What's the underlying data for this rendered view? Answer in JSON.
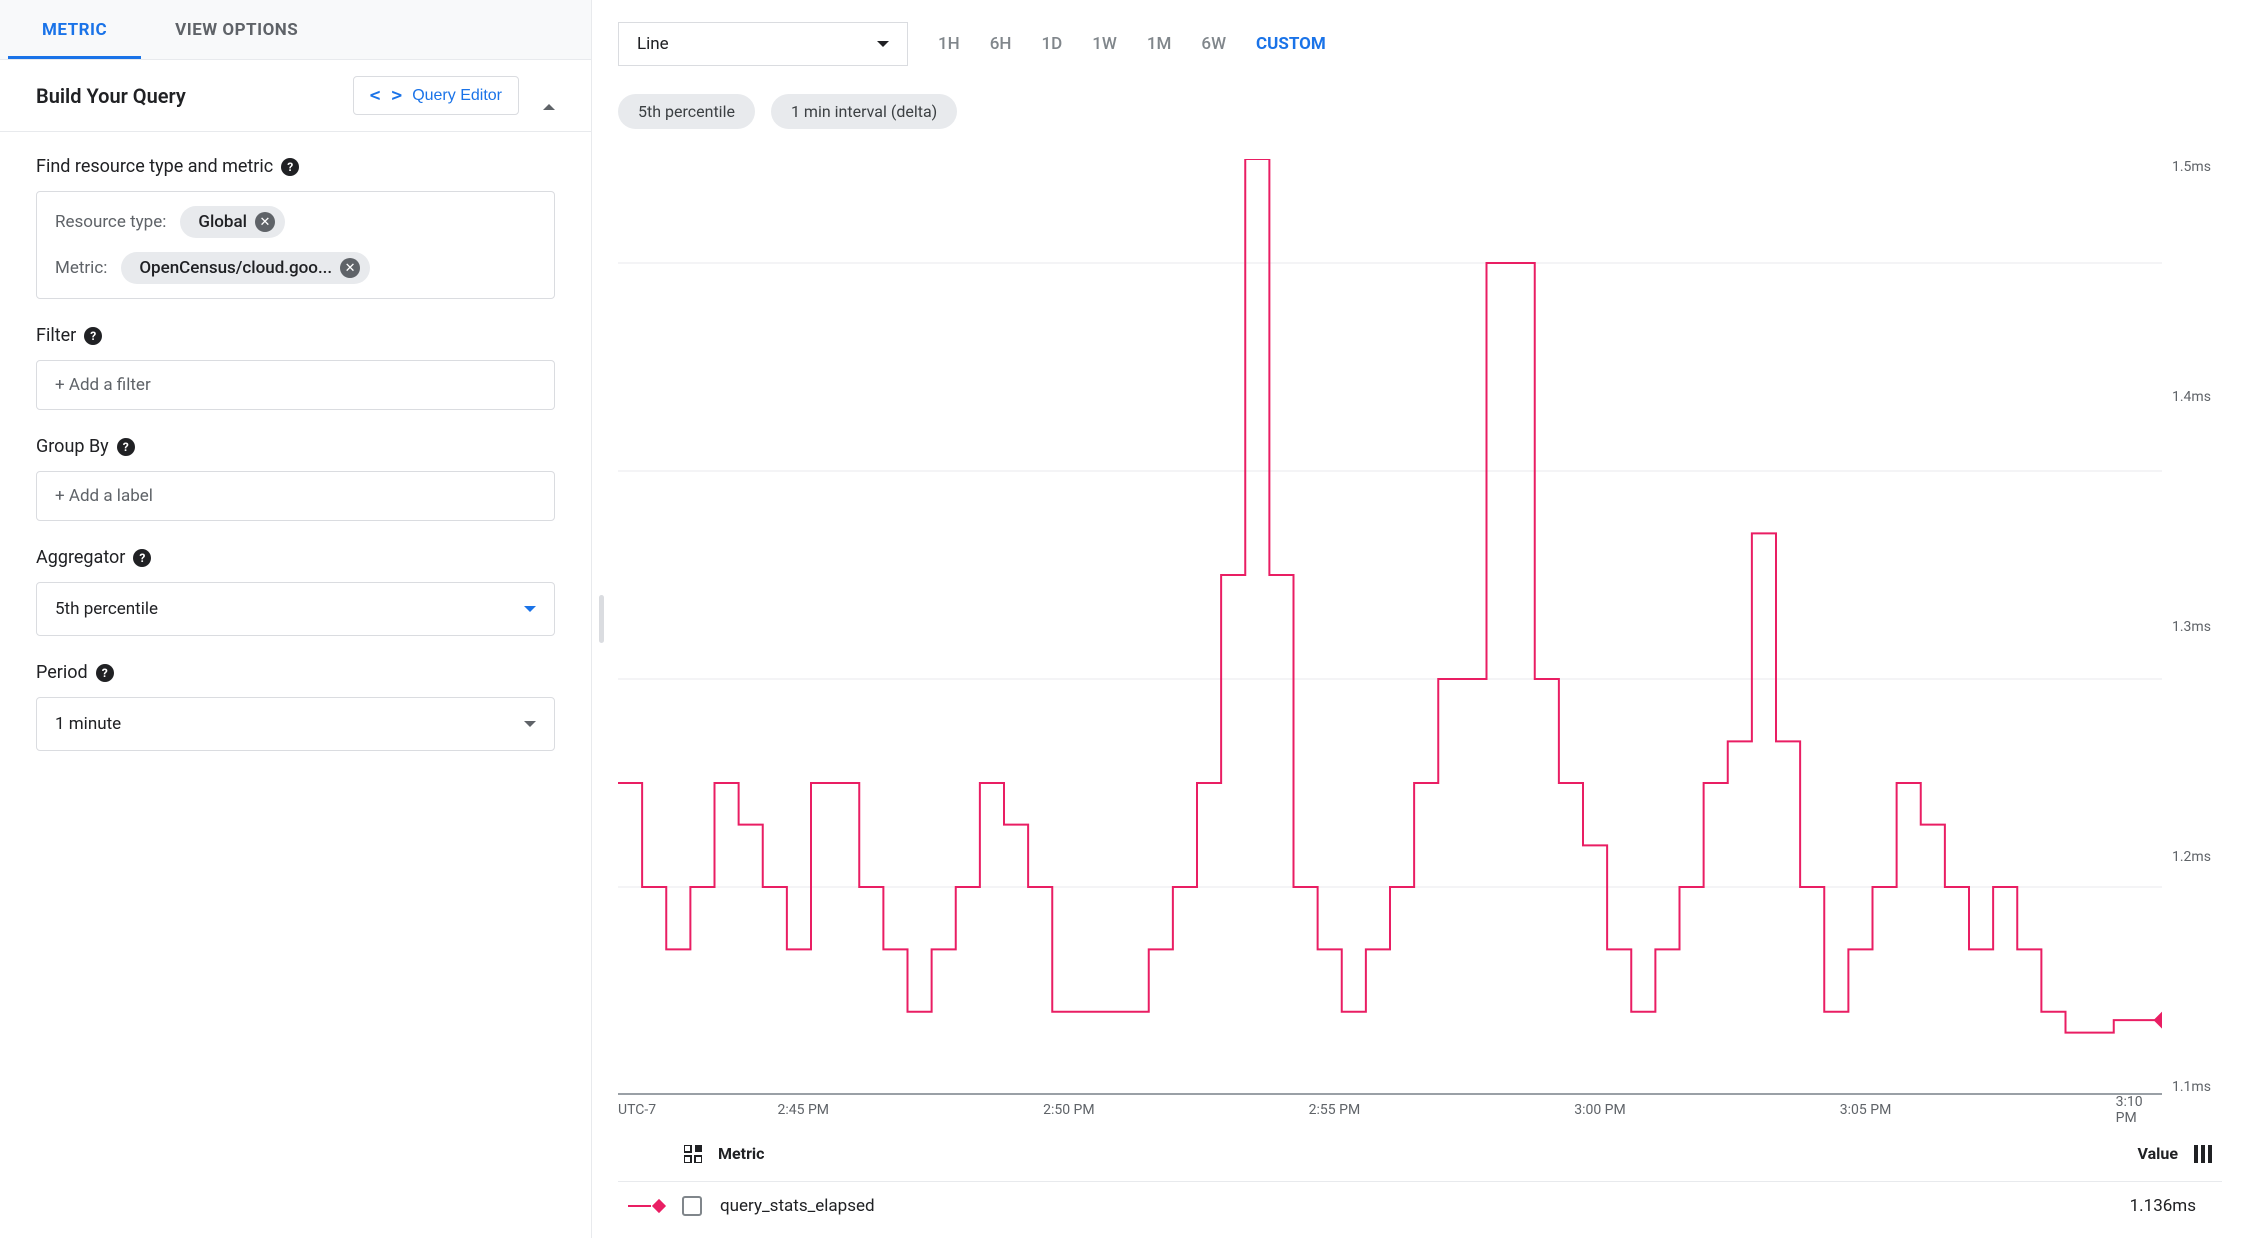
{
  "tabs": {
    "metric": "METRIC",
    "view_options": "VIEW OPTIONS"
  },
  "card": {
    "title": "Build Your Query",
    "query_editor": "Query Editor"
  },
  "find": {
    "label": "Find resource type and metric",
    "resource_type_label": "Resource type:",
    "metric_label": "Metric:",
    "resource_type_value": "Global",
    "metric_value": "OpenCensus/cloud.goo..."
  },
  "filter": {
    "label": "Filter",
    "placeholder": "+ Add a filter"
  },
  "group_by": {
    "label": "Group By",
    "placeholder": "+ Add a label"
  },
  "aggregator": {
    "label": "Aggregator",
    "value": "5th percentile"
  },
  "period": {
    "label": "Period",
    "value": "1 minute"
  },
  "chart_controls": {
    "chart_type": "Line",
    "time_ranges": [
      "1H",
      "6H",
      "1D",
      "1W",
      "1M",
      "6W",
      "CUSTOM"
    ],
    "active_range": "CUSTOM"
  },
  "pills": {
    "p1": "5th percentile",
    "p2": "1 min interval (delta)"
  },
  "legend": {
    "metric_header": "Metric",
    "value_header": "Value",
    "series_name": "query_stats_elapsed",
    "series_value": "1.136ms"
  },
  "chart_data": {
    "type": "line",
    "title": "",
    "xlabel": "",
    "ylabel": "",
    "timezone": "UTC-7",
    "x_ticks": [
      "2:45 PM",
      "2:50 PM",
      "2:55 PM",
      "3:00 PM",
      "3:05 PM",
      "3:10 PM"
    ],
    "y_ticks_ms": [
      1.1,
      1.2,
      1.3,
      1.4,
      1.5
    ],
    "ylim_ms": [
      1.1,
      1.55
    ],
    "series": [
      {
        "name": "query_stats_elapsed",
        "color": "#e91e63",
        "x": [
          0,
          1,
          2,
          3,
          4,
          5,
          6,
          7,
          8,
          9,
          10,
          11,
          12,
          13,
          14,
          15,
          16,
          17,
          18,
          19,
          20,
          21,
          22,
          23,
          24,
          25,
          26,
          27,
          28,
          29,
          30,
          31,
          32,
          33,
          34,
          35,
          36,
          37,
          38,
          39,
          40,
          41,
          42,
          43,
          44,
          45,
          46,
          47,
          48,
          49,
          50,
          51,
          52,
          53,
          54,
          55,
          56,
          57,
          58,
          59,
          60,
          61,
          62,
          63,
          64
        ],
        "y_ms": [
          1.25,
          1.2,
          1.17,
          1.2,
          1.25,
          1.23,
          1.2,
          1.17,
          1.25,
          1.25,
          1.2,
          1.17,
          1.14,
          1.17,
          1.2,
          1.25,
          1.23,
          1.2,
          1.14,
          1.14,
          1.14,
          1.14,
          1.17,
          1.2,
          1.25,
          1.35,
          1.55,
          1.35,
          1.2,
          1.17,
          1.14,
          1.17,
          1.2,
          1.25,
          1.3,
          1.3,
          1.5,
          1.5,
          1.3,
          1.25,
          1.22,
          1.17,
          1.14,
          1.17,
          1.2,
          1.25,
          1.27,
          1.37,
          1.27,
          1.2,
          1.14,
          1.17,
          1.2,
          1.25,
          1.23,
          1.2,
          1.17,
          1.2,
          1.17,
          1.14,
          1.13,
          1.13,
          1.136,
          1.136,
          1.136
        ]
      }
    ]
  }
}
